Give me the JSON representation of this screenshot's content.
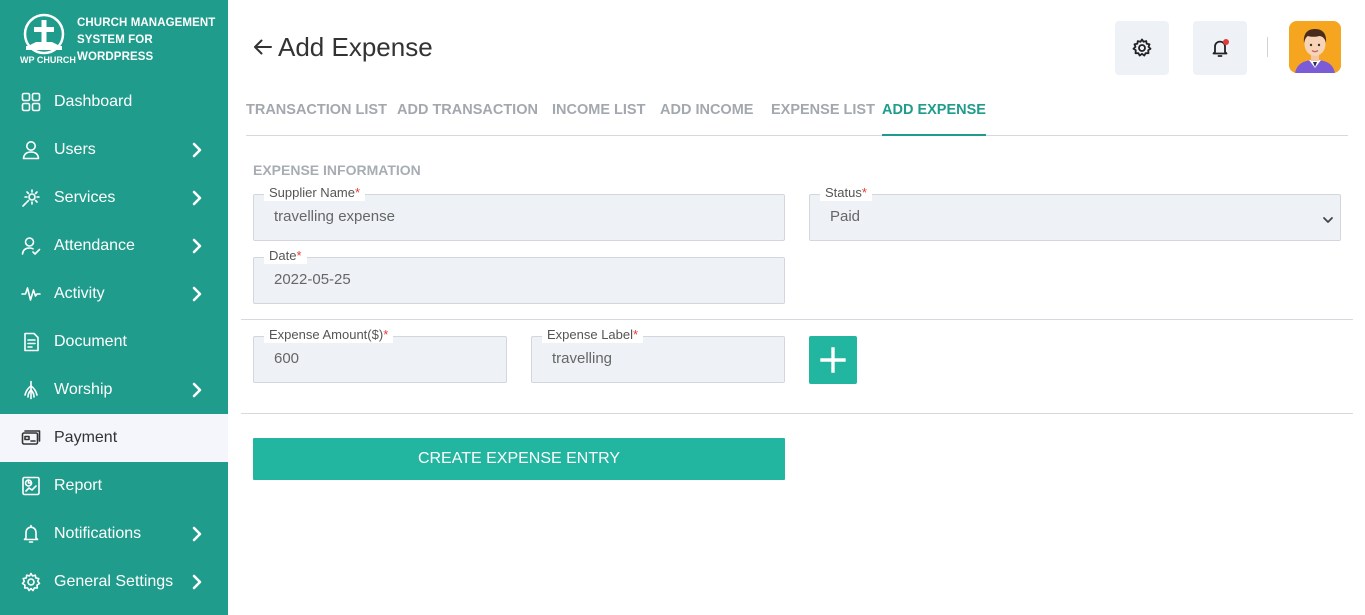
{
  "brand": {
    "logo_text": "WP CHURCH",
    "line1": "CHURCH MANAGEMENT",
    "line2": "SYSTEM FOR",
    "line3": "WORDPRESS"
  },
  "sidebar": {
    "items": [
      {
        "label": "Dashboard",
        "icon": "grid-icon",
        "has_arrow": false
      },
      {
        "label": "Users",
        "icon": "user-icon",
        "has_arrow": true
      },
      {
        "label": "Services",
        "icon": "services-icon",
        "has_arrow": true
      },
      {
        "label": "Attendance",
        "icon": "attendance-icon",
        "has_arrow": true
      },
      {
        "label": "Activity",
        "icon": "pulse-icon",
        "has_arrow": true
      },
      {
        "label": "Document",
        "icon": "document-icon",
        "has_arrow": false
      },
      {
        "label": "Worship",
        "icon": "worship-icon",
        "has_arrow": true
      },
      {
        "label": "Payment",
        "icon": "payment-icon",
        "has_arrow": false,
        "active": true
      },
      {
        "label": "Report",
        "icon": "report-icon",
        "has_arrow": false
      },
      {
        "label": "Notifications",
        "icon": "bell-icon",
        "has_arrow": true
      },
      {
        "label": "General Settings",
        "icon": "gear-icon",
        "has_arrow": true
      }
    ]
  },
  "header": {
    "title": "Add Expense",
    "back_icon": "arrow-left-icon",
    "settings_icon": "gear-icon",
    "notification_icon": "bell-icon"
  },
  "tabs": [
    {
      "label": "TRANSACTION LIST",
      "active": false
    },
    {
      "label": "ADD TRANSACTION",
      "active": false
    },
    {
      "label": "INCOME LIST",
      "active": false
    },
    {
      "label": "ADD INCOME",
      "active": false
    },
    {
      "label": "EXPENSE LIST",
      "active": false
    },
    {
      "label": "ADD EXPENSE",
      "active": true
    }
  ],
  "form": {
    "section_title": "EXPENSE INFORMATION",
    "supplier_name": {
      "label": "Supplier Name",
      "value": "travelling expense"
    },
    "status": {
      "label": "Status",
      "value": "Paid"
    },
    "date": {
      "label": "Date",
      "value": "2022-05-25"
    },
    "expense_amount": {
      "label": "Expense Amount($)",
      "value": "600"
    },
    "expense_label": {
      "label": "Expense Label",
      "value": "travelling"
    },
    "required_mark": "*",
    "submit_label": "CREATE EXPENSE ENTRY"
  },
  "colors": {
    "sidebar": "#1f9c8c",
    "accent": "#22b5a0",
    "field_bg": "#eef1f6",
    "required": "#e53935"
  }
}
